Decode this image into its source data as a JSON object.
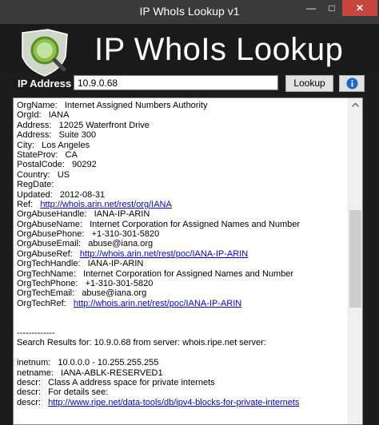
{
  "window": {
    "title": "IP WhoIs Lookup v1"
  },
  "header": {
    "app_title": "IP WhoIs Lookup"
  },
  "search": {
    "label": "IP Address :",
    "value": "10.9.0.68",
    "lookup_label": "Lookup"
  },
  "results": [
    {
      "k": "OrgName:",
      "v": "Internet Assigned Numbers Authority",
      "link": false
    },
    {
      "k": "OrgId:",
      "v": "IANA",
      "link": false
    },
    {
      "k": "Address:",
      "v": "12025 Waterfront Drive",
      "link": false
    },
    {
      "k": "Address:",
      "v": "Suite 300",
      "link": false
    },
    {
      "k": "City:",
      "v": "Los Angeles",
      "link": false
    },
    {
      "k": "StateProv:",
      "v": "CA",
      "link": false
    },
    {
      "k": "PostalCode:",
      "v": "90292",
      "link": false
    },
    {
      "k": "Country:",
      "v": "US",
      "link": false
    },
    {
      "k": "RegDate:",
      "v": "",
      "link": false
    },
    {
      "k": "Updated:",
      "v": "2012-08-31",
      "link": false
    },
    {
      "k": "Ref:",
      "v": "http://whois.arin.net/rest/org/IANA",
      "link": true
    },
    {
      "k": "OrgAbuseHandle:",
      "v": "IANA-IP-ARIN",
      "link": false
    },
    {
      "k": "OrgAbuseName:",
      "v": "Internet Corporation for Assigned Names and Number",
      "link": false
    },
    {
      "k": "OrgAbusePhone:",
      "v": "+1-310-301-5820",
      "link": false
    },
    {
      "k": "OrgAbuseEmail:",
      "v": "abuse@iana.org",
      "link": false
    },
    {
      "k": "OrgAbuseRef:",
      "v": "http://whois.arin.net/rest/poc/IANA-IP-ARIN",
      "link": true
    },
    {
      "k": "OrgTechHandle:",
      "v": "IANA-IP-ARIN",
      "link": false
    },
    {
      "k": "OrgTechName:",
      "v": "Internet Corporation for Assigned Names and Number",
      "link": false
    },
    {
      "k": "OrgTechPhone:",
      "v": "+1-310-301-5820",
      "link": false
    },
    {
      "k": "OrgTechEmail:",
      "v": "abuse@iana.org",
      "link": false
    },
    {
      "k": "OrgTechRef:",
      "v": "http://whois.arin.net/rest/poc/IANA-IP-ARIN",
      "link": true
    },
    {
      "k": "",
      "v": "",
      "link": false
    },
    {
      "k": "",
      "v": "",
      "link": false
    },
    {
      "k": "-------------",
      "v": "",
      "link": false
    },
    {
      "k": "Search Results for: 10.9.0.68 from server: whois.ripe.net server:",
      "v": "",
      "link": false
    },
    {
      "k": "",
      "v": "",
      "link": false
    },
    {
      "k": "inetnum:",
      "v": "10.0.0.0 - 10.255.255.255",
      "link": false
    },
    {
      "k": "netname:",
      "v": "IANA-ABLK-RESERVED1",
      "link": false
    },
    {
      "k": "descr:",
      "v": "Class A address space for private internets",
      "link": false
    },
    {
      "k": "descr:",
      "v": "For details see:",
      "link": false
    },
    {
      "k": "descr:",
      "v": "http://www.ripe.net/data-tools/db/ipv4-blocks-for-private-internets",
      "link": true
    }
  ]
}
